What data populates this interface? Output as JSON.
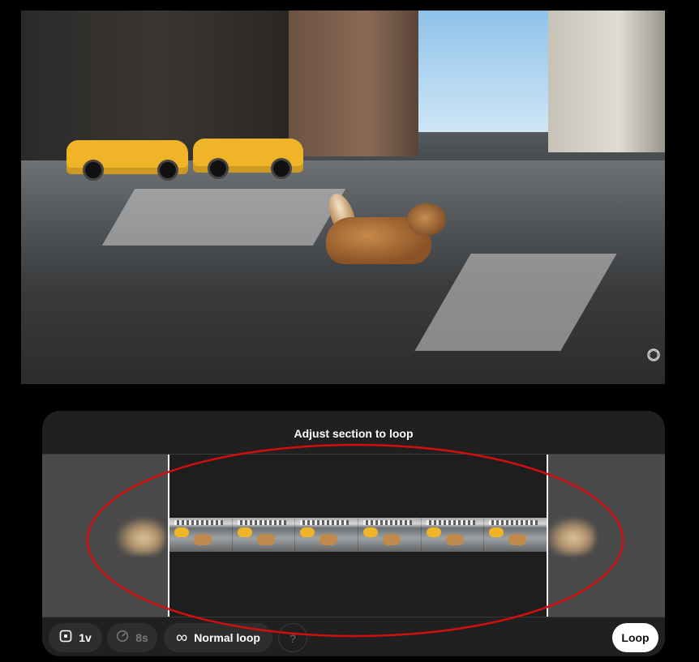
{
  "video": {
    "description_icon": "openai-watermark-icon"
  },
  "panel": {
    "title": "Adjust section to loop",
    "frame_count": 6
  },
  "toolbar": {
    "version_label": "1v",
    "duration_label": "8s",
    "loop_mode_label": "Normal loop",
    "help_label": "?",
    "loop_button_label": "Loop"
  },
  "colors": {
    "panel_bg": "#202020",
    "pill_bg": "#2e2e2e",
    "annotation": "#d10f0f",
    "taxi": "#f0b428"
  }
}
